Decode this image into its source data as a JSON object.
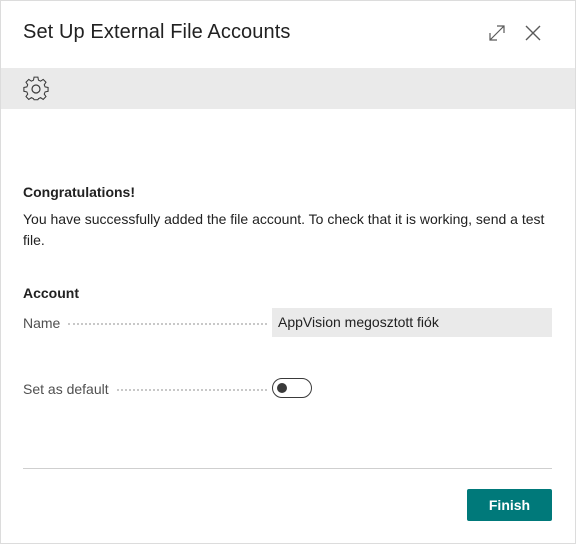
{
  "dialog": {
    "title": "Set Up External File Accounts",
    "expand_icon": "expand-diagonal-icon",
    "close_icon": "close-icon"
  },
  "toolbar": {
    "settings_icon": "gear-icon"
  },
  "content": {
    "heading": "Congratulations!",
    "message": "You have successfully added the file account. To check that it is working, send a test file."
  },
  "account": {
    "section_title": "Account",
    "name_label": "Name",
    "name_value": "AppVision megosztott fiók",
    "default_label": "Set as default",
    "default_on": false
  },
  "footer": {
    "finish_label": "Finish"
  },
  "colors": {
    "accent": "#00797a",
    "toolbar_bg": "#eaeaea"
  }
}
